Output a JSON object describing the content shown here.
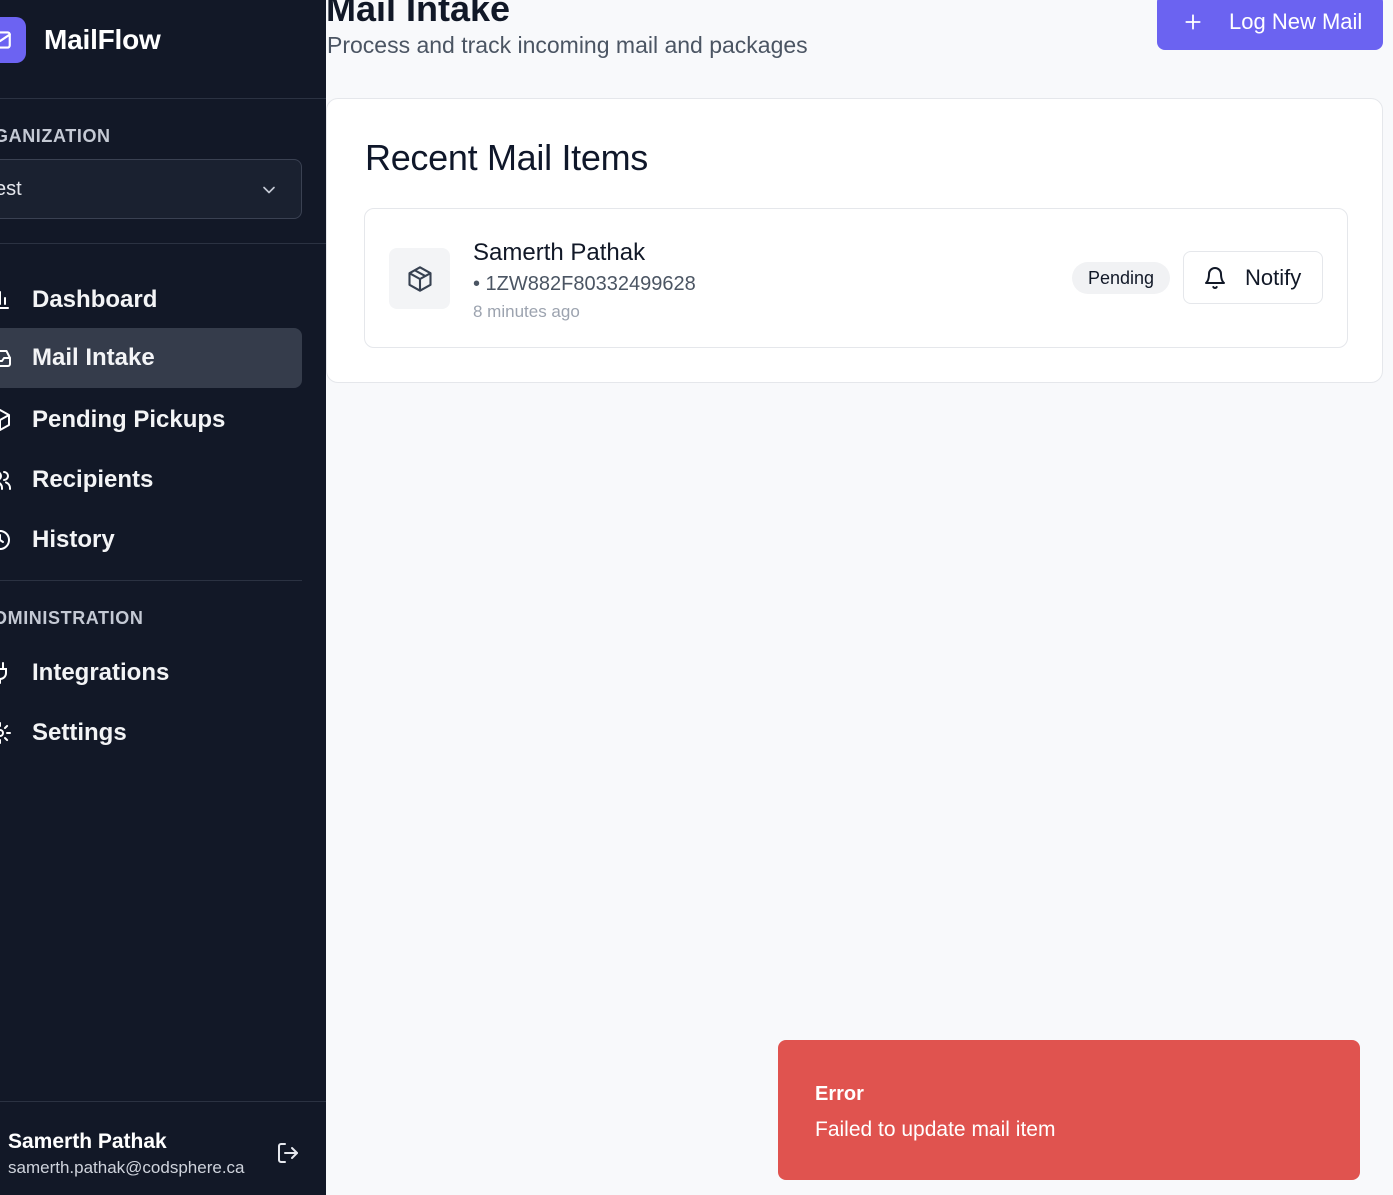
{
  "app": {
    "name": "MailFlow"
  },
  "sidebar": {
    "org_label": "GANIZATION",
    "org_value": "est",
    "nav": [
      {
        "label": "Dashboard",
        "icon": "bar-chart-icon"
      },
      {
        "label": "Mail Intake",
        "icon": "inbox-icon",
        "active": true
      },
      {
        "label": "Pending Pickups",
        "icon": "package-icon"
      },
      {
        "label": "Recipients",
        "icon": "users-icon"
      },
      {
        "label": "History",
        "icon": "clock-icon"
      }
    ],
    "admin_label": "DMINISTRATION",
    "admin_nav": [
      {
        "label": "Integrations",
        "icon": "plug-icon"
      },
      {
        "label": "Settings",
        "icon": "gear-icon"
      }
    ],
    "user": {
      "name": "Samerth Pathak",
      "email": "samerth.pathak@codsphere.ca"
    }
  },
  "header": {
    "title": "Mail Intake",
    "subtitle": "Process and track incoming mail and packages",
    "log_button": "Log New Mail"
  },
  "recent": {
    "title": "Recent Mail Items",
    "items": [
      {
        "recipient": "Samerth Pathak",
        "tracking": "• 1ZW882F80332499628",
        "time": "8 minutes ago",
        "status": "Pending",
        "notify_label": "Notify"
      }
    ]
  },
  "toast": {
    "title": "Error",
    "message": "Failed to update mail item"
  },
  "colors": {
    "accent": "#6b63f1",
    "sidebar_bg": "#121827",
    "error": "#e0534f"
  }
}
